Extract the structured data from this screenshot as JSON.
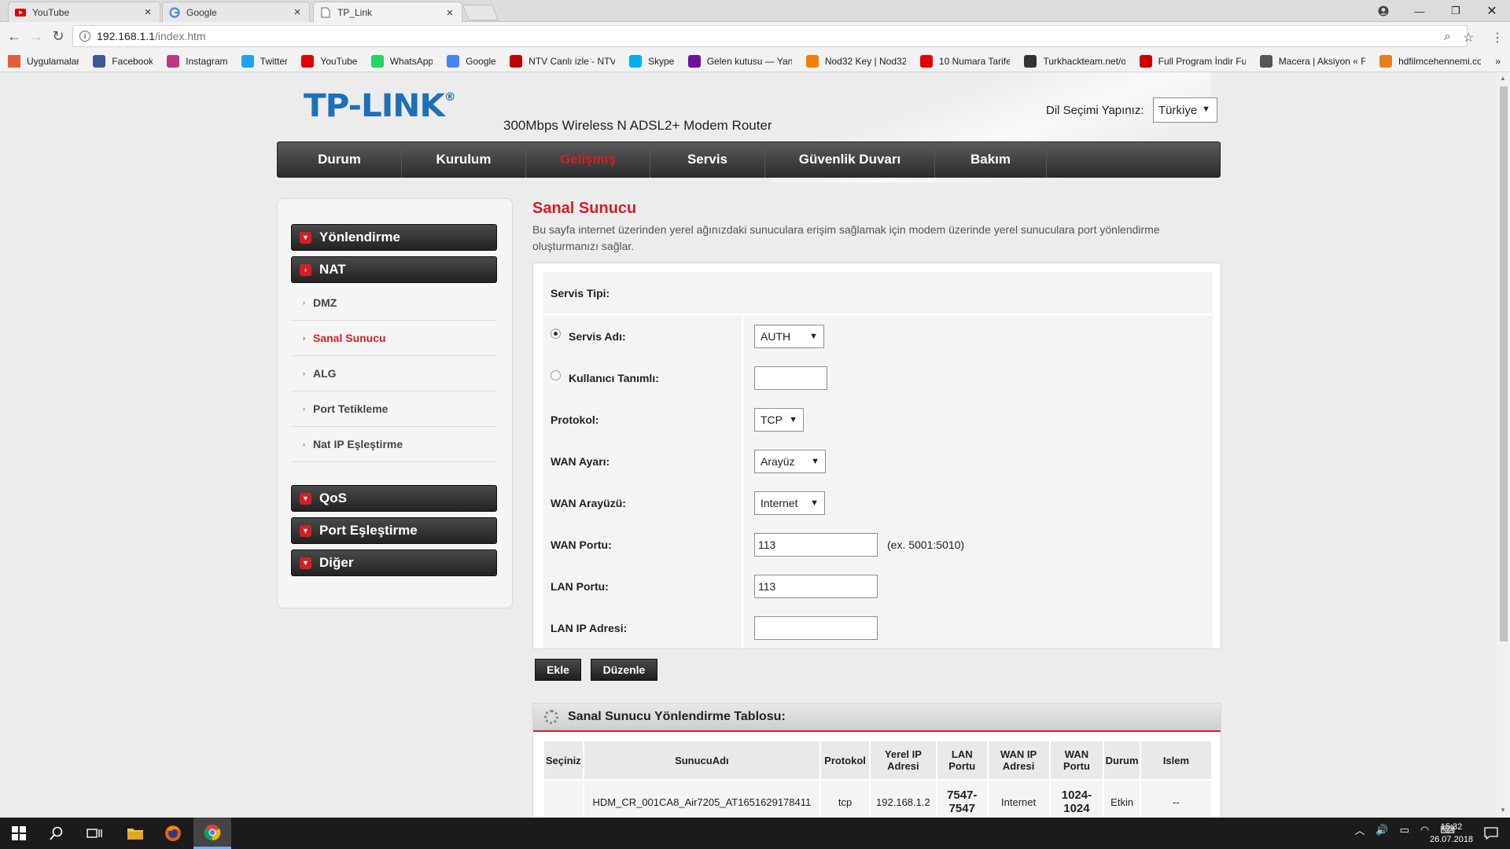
{
  "browser": {
    "tabs": [
      {
        "title": "YouTube",
        "icon": "youtube-icon"
      },
      {
        "title": "Google",
        "icon": "google-icon"
      },
      {
        "title": "TP_Link",
        "icon": "page-icon"
      }
    ],
    "url_host": "192.168.1.1",
    "url_path": "/index.htm",
    "bookmarks": [
      {
        "label": "Uygulamalar",
        "icon": "apps-grid-icon",
        "color": "#e35d3d"
      },
      {
        "label": "Facebook",
        "icon": "facebook-icon",
        "color": "#3b5998"
      },
      {
        "label": "Instagram",
        "icon": "instagram-icon",
        "color": "#c13584"
      },
      {
        "label": "Twitter",
        "icon": "twitter-icon",
        "color": "#1da1f2"
      },
      {
        "label": "YouTube",
        "icon": "youtube-icon",
        "color": "#e00000"
      },
      {
        "label": "WhatsApp",
        "icon": "whatsapp-icon",
        "color": "#25d366"
      },
      {
        "label": "Google",
        "icon": "google-icon",
        "color": "#4285f4"
      },
      {
        "label": "NTV Canlı izle - NTV",
        "icon": "ntv-icon",
        "color": "#c00000"
      },
      {
        "label": "Skype",
        "icon": "skype-icon",
        "color": "#00aff0"
      },
      {
        "label": "Gelen kutusu — Yan",
        "icon": "yahoo-icon",
        "color": "#720e9e"
      },
      {
        "label": "Nod32 Key | Nod32",
        "icon": "blogger-icon",
        "color": "#f57d00"
      },
      {
        "label": "10 Numara Tarife",
        "icon": "vodafone-icon",
        "color": "#e60000"
      },
      {
        "label": "Turkhackteam.net/o",
        "icon": "turkhackteam-icon",
        "color": "#333333"
      },
      {
        "label": "Full Program İndir Fu",
        "icon": "download-icon",
        "color": "#cc0000"
      },
      {
        "label": "Macera | Aksiyon « F",
        "icon": "mask-icon",
        "color": "#555555"
      },
      {
        "label": "hdfilmcehennemi.co",
        "icon": "hdfilm-icon",
        "color": "#e67e22"
      }
    ]
  },
  "header": {
    "logo_text": "TP-LINK",
    "logo_mark": "®",
    "subtitle": "300Mbps Wireless N ADSL2+ Modem Router",
    "lang_label": "Dil Seçimi Yapınız:",
    "lang_value": "Türkiye"
  },
  "nav": [
    {
      "label": "Durum",
      "active": false
    },
    {
      "label": "Kurulum",
      "active": false
    },
    {
      "label": "Gelişmiş",
      "active": true
    },
    {
      "label": "Servis",
      "active": false
    },
    {
      "label": "Güvenlik Duvarı",
      "active": false
    },
    {
      "label": "Bakım",
      "active": false
    }
  ],
  "sidebar": {
    "groups": [
      {
        "label": "Yönlendirme"
      },
      {
        "label": "NAT"
      },
      {
        "label": "QoS"
      },
      {
        "label": "Port Eşleştirme"
      },
      {
        "label": "Diğer"
      }
    ],
    "nat_items": [
      {
        "label": "DMZ"
      },
      {
        "label": "Sanal Sunucu"
      },
      {
        "label": "ALG"
      },
      {
        "label": "Port Tetikleme"
      },
      {
        "label": "Nat IP Eşleştirme"
      }
    ]
  },
  "content": {
    "title": "Sanal Sunucu",
    "description": "Bu sayfa internet üzerinden yerel ağınızdaki sunuculara erişim sağlamak için modem üzerinde yerel sunuculara port yönlendirme oluşturmanızı sağlar."
  },
  "form": {
    "service_type_label": "Servis Tipi:",
    "service_name_label": "Servis Adı:",
    "service_name_value": "AUTH",
    "user_defined_label": "Kullanıcı Tanımlı:",
    "user_defined_value": "",
    "protocol_label": "Protokol:",
    "protocol_value": "TCP",
    "wan_setting_label": "WAN Ayarı:",
    "wan_setting_value": "Arayüz",
    "wan_interface_label": "WAN Arayüzü:",
    "wan_interface_value": "Internet",
    "wan_port_label": "WAN Portu:",
    "wan_port_value": "113",
    "wan_port_hint": "(ex. 5001:5010)",
    "lan_port_label": "LAN Portu:",
    "lan_port_value": "113",
    "lan_ip_label": "LAN IP Adresi:",
    "lan_ip_value": "",
    "add_button": "Ekle",
    "edit_button": "Düzenle"
  },
  "table": {
    "title": "Sanal Sunucu Yönlendirme Tablosu:",
    "headers": [
      "Seçiniz",
      "SunucuAdı",
      "Protokol",
      "Yerel IP Adresi",
      "LAN Portu",
      "WAN IP Adresi",
      "WAN Portu",
      "Durum",
      "Islem"
    ],
    "rows": [
      [
        "",
        "HDM_CR_001CA8_Air7205_AT1651629178411",
        "tcp",
        "192.168.1.2",
        "7547-7547",
        "Internet",
        "1024-1024",
        "Etkin",
        "--"
      ]
    ]
  },
  "taskbar": {
    "time": "15:32",
    "date": "26.07.2018"
  },
  "colors": {
    "accent_red": "#d31f25",
    "logo_blue": "#1f6fb6"
  }
}
